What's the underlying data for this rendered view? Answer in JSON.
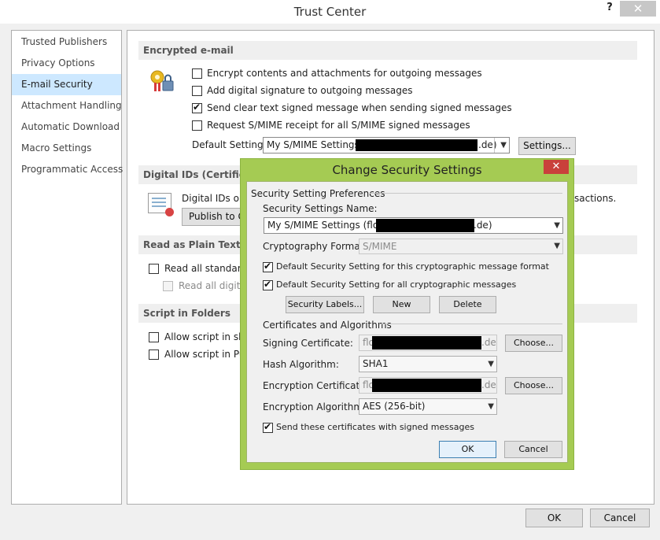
{
  "window": {
    "title": "Trust Center",
    "help": "?",
    "close": "✕"
  },
  "sidebar": {
    "items": [
      {
        "label": "Trusted Publishers"
      },
      {
        "label": "Privacy Options"
      },
      {
        "label": "E-mail Security",
        "selected": true
      },
      {
        "label": "Attachment Handling"
      },
      {
        "label": "Automatic Download"
      },
      {
        "label": "Macro Settings"
      },
      {
        "label": "Programmatic Access"
      }
    ]
  },
  "encrypted": {
    "header": "Encrypted e-mail",
    "opt1": "Encrypt contents and attachments for outgoing messages",
    "opt2": "Add digital signature to outgoing messages",
    "opt3": "Send clear text signed message when sending signed messages",
    "opt4": "Request S/MIME receipt for all S/MIME signed messages",
    "opt1_checked": false,
    "opt2_checked": false,
    "opt3_checked": true,
    "opt4_checked": false,
    "default_setting_label": "Default Setting:",
    "default_setting_prefix": "My S/MIME Settings (flo",
    "default_setting_suffix": ".de)",
    "settings_button": "Settings..."
  },
  "digital_ids": {
    "header": "Digital IDs (Certificate",
    "text_left": "Digital IDs or C",
    "text_right": "sactions.",
    "publish_button": "Publish to G"
  },
  "plain_text": {
    "header": "Read as Plain Text",
    "opt1": "Read all standard r",
    "opt2": "Read all digital",
    "opt1_checked": false,
    "opt2_checked": false
  },
  "script_folders": {
    "header": "Script in Folders",
    "opt1": "Allow script in sha",
    "opt2": "Allow script in Pub",
    "opt1_checked": false,
    "opt2_checked": false
  },
  "footer": {
    "ok": "OK",
    "cancel": "Cancel"
  },
  "dialog": {
    "title": "Change Security Settings",
    "close": "✕",
    "group1": "Security Setting Preferences",
    "name_label": "Security Settings Name:",
    "name_prefix": "My S/MIME Settings (flo",
    "name_suffix": ".de)",
    "crypto_label": "Cryptography Format:",
    "crypto_value": "S/MIME",
    "default_format": "Default Security Setting for this cryptographic message format",
    "default_all": "Default Security Setting for all cryptographic messages",
    "default_format_checked": true,
    "default_all_checked": true,
    "security_labels_btn": "Security Labels...",
    "new_btn": "New",
    "delete_btn": "Delete",
    "group2": "Certificates and Algorithms",
    "signing_label": "Signing Certificate:",
    "signing_prefix": "flo",
    "signing_suffix": ".de",
    "choose1": "Choose...",
    "hash_label": "Hash Algorithm:",
    "hash_value": "SHA1",
    "enc_cert_label": "Encryption Certificate:",
    "enc_prefix": "flo",
    "enc_suffix": ".de",
    "choose2": "Choose...",
    "enc_alg_label": "Encryption Algorithm:",
    "enc_alg_value": "AES (256-bit)",
    "send_certs": "Send these certificates with signed messages",
    "send_certs_checked": true,
    "ok": "OK",
    "cancel": "Cancel"
  }
}
